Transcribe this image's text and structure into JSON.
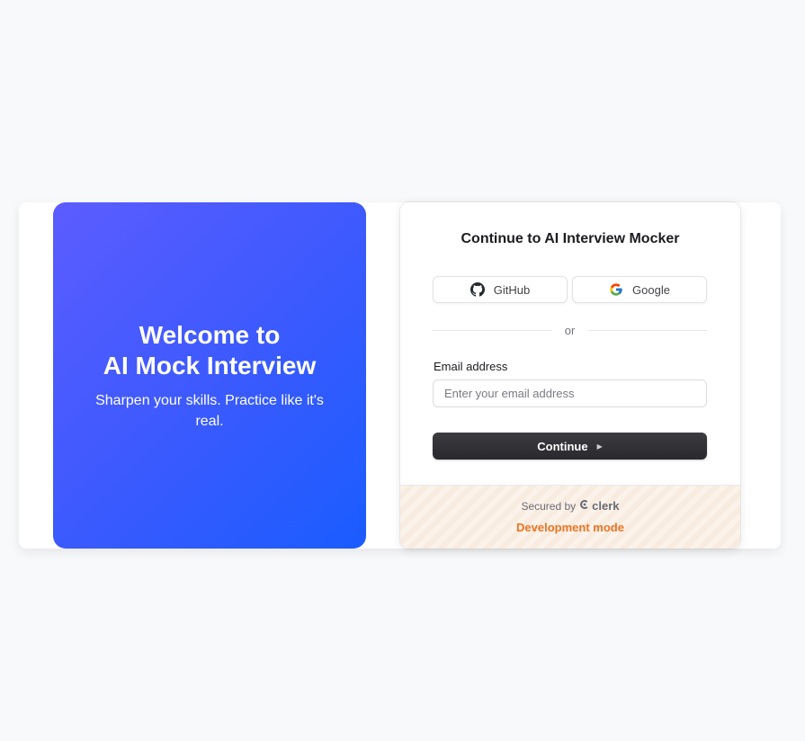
{
  "hero": {
    "title_line1": "Welcome to",
    "title_line2": "AI Mock Interview",
    "subtitle": "Sharpen your skills. Practice like it's real."
  },
  "signin": {
    "title": "Continue to AI Interview Mocker",
    "social": [
      {
        "label": "GitHub",
        "icon": "github-icon"
      },
      {
        "label": "Google",
        "icon": "google-icon"
      }
    ],
    "divider_text": "or",
    "email_label": "Email address",
    "email_placeholder": "Enter your email address",
    "email_value": "",
    "continue_label": "Continue",
    "continue_icon": "triangle-right-icon"
  },
  "footer": {
    "secured_by": "Secured by",
    "brand": "clerk",
    "dev_mode": "Development mode"
  },
  "colors": {
    "hero_gradient_start": "#5c5cff",
    "hero_gradient_end": "#1a5cff",
    "primary_button": "#2f2f33",
    "dev_mode": "#f0731f"
  }
}
